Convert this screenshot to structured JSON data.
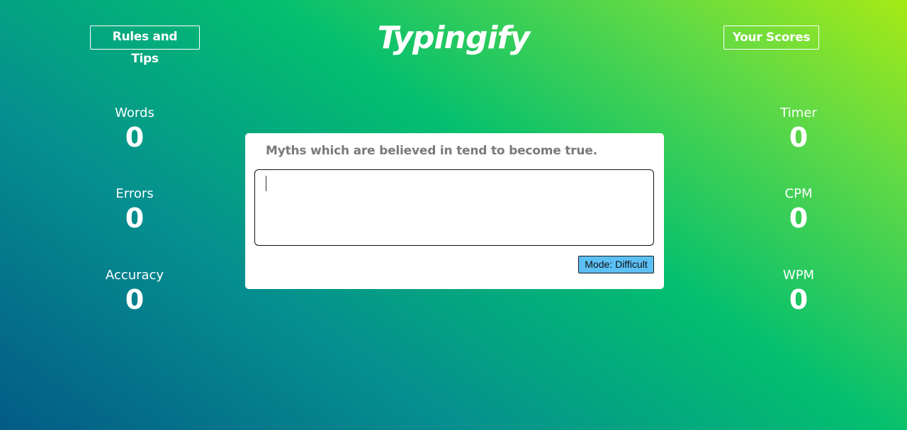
{
  "header": {
    "rules_label": "Rules and Tips",
    "title": "Typingify",
    "scores_label": "Your Scores"
  },
  "stats_left": [
    {
      "label": "Words",
      "value": "0"
    },
    {
      "label": "Errors",
      "value": "0"
    },
    {
      "label": "Accuracy",
      "value": "0"
    }
  ],
  "stats_right": [
    {
      "label": "Timer",
      "value": "0"
    },
    {
      "label": "CPM",
      "value": "0"
    },
    {
      "label": "WPM",
      "value": "0"
    }
  ],
  "card": {
    "quote": "Myths which are believed in tend to become true.",
    "input_value": "",
    "mode_label": "Mode: Difficult"
  },
  "colors": {
    "mode_button": "#5cc0f5",
    "quote_text": "#7a7a7a",
    "gradient_start": "#045b86",
    "gradient_end": "#a6ea15"
  }
}
